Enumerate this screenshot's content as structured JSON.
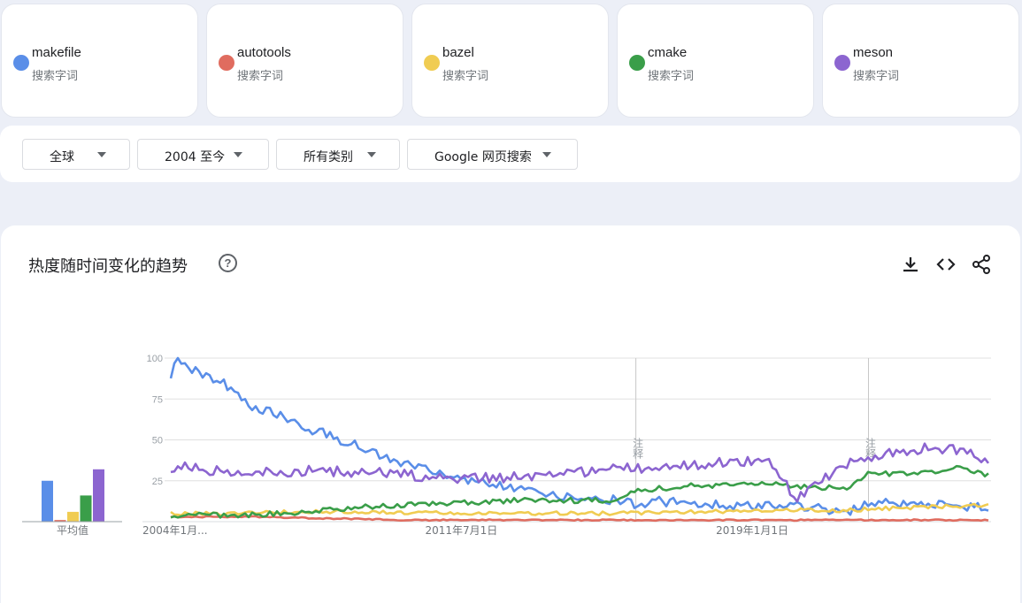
{
  "terms": [
    {
      "name": "makefile",
      "subtitle": "搜索字词",
      "color": "#5a8ee8"
    },
    {
      "name": "autotools",
      "subtitle": "搜索字词",
      "color": "#e06c5f"
    },
    {
      "name": "bazel",
      "subtitle": "搜索字词",
      "color": "#f0cc52"
    },
    {
      "name": "cmake",
      "subtitle": "搜索字词",
      "color": "#3a9e49"
    },
    {
      "name": "meson",
      "subtitle": "搜索字词",
      "color": "#8c65d0"
    }
  ],
  "filters": {
    "region": "全球",
    "time": "2004 至今",
    "category": "所有类别",
    "property": "Google 网页搜索"
  },
  "chart": {
    "title": "热度随时间变化的趋势",
    "help": "?",
    "avg_label": "平均值",
    "x_labels": [
      "2004年1月...",
      "2011年7月1日",
      "2019年1月1日"
    ],
    "y_ticks": [
      "100",
      "75",
      "50",
      "25"
    ],
    "note_label": "注释"
  },
  "chart_data": {
    "type": "line",
    "xlabel": "",
    "ylabel": "",
    "ylim": [
      0,
      100
    ],
    "x_start": "2004-01",
    "x_end": "2025-03",
    "grid": true,
    "notes_at": [
      "2016-01",
      "2022-01"
    ],
    "averages": [
      {
        "name": "makefile",
        "value": 25
      },
      {
        "name": "autotools",
        "value": 1
      },
      {
        "name": "bazel",
        "value": 6
      },
      {
        "name": "cmake",
        "value": 16
      },
      {
        "name": "meson",
        "value": 32
      }
    ],
    "series": [
      {
        "name": "makefile",
        "color": "#5a8ee8",
        "values": [
          {
            "x": "2004-01",
            "y": 88
          },
          {
            "x": "2004-03",
            "y": 100
          },
          {
            "x": "2004-09",
            "y": 92
          },
          {
            "x": "2005-06",
            "y": 84
          },
          {
            "x": "2006-01",
            "y": 72
          },
          {
            "x": "2006-09",
            "y": 66
          },
          {
            "x": "2007-06",
            "y": 58
          },
          {
            "x": "2008-06",
            "y": 50
          },
          {
            "x": "2009-06",
            "y": 40
          },
          {
            "x": "2010-06",
            "y": 33
          },
          {
            "x": "2011-06",
            "y": 27
          },
          {
            "x": "2012-06",
            "y": 22
          },
          {
            "x": "2013-06",
            "y": 17
          },
          {
            "x": "2014-06",
            "y": 14
          },
          {
            "x": "2015-06",
            "y": 13
          },
          {
            "x": "2016-01",
            "y": 10
          },
          {
            "x": "2016-06",
            "y": 13
          },
          {
            "x": "2017-06",
            "y": 11
          },
          {
            "x": "2018-06",
            "y": 10
          },
          {
            "x": "2019-06",
            "y": 10
          },
          {
            "x": "2020-06",
            "y": 9
          },
          {
            "x": "2021-06",
            "y": 6
          },
          {
            "x": "2022-01",
            "y": 12
          },
          {
            "x": "2023-01",
            "y": 10
          },
          {
            "x": "2024-01",
            "y": 10
          },
          {
            "x": "2025-03",
            "y": 8
          }
        ]
      },
      {
        "name": "autotools",
        "color": "#e06c5f",
        "values": [
          {
            "x": "2004-01",
            "y": 3
          },
          {
            "x": "2006-01",
            "y": 3
          },
          {
            "x": "2008-01",
            "y": 2
          },
          {
            "x": "2010-01",
            "y": 1
          },
          {
            "x": "2014-01",
            "y": 1
          },
          {
            "x": "2018-01",
            "y": 1
          },
          {
            "x": "2022-01",
            "y": 1
          },
          {
            "x": "2025-03",
            "y": 1
          }
        ]
      },
      {
        "name": "bazel",
        "color": "#f0cc52",
        "values": [
          {
            "x": "2004-01",
            "y": 5
          },
          {
            "x": "2005-06",
            "y": 5
          },
          {
            "x": "2007-06",
            "y": 6
          },
          {
            "x": "2009-06",
            "y": 6
          },
          {
            "x": "2011-06",
            "y": 5
          },
          {
            "x": "2013-06",
            "y": 5
          },
          {
            "x": "2015-06",
            "y": 5
          },
          {
            "x": "2017-06",
            "y": 6
          },
          {
            "x": "2019-06",
            "y": 7
          },
          {
            "x": "2021-06",
            "y": 7
          },
          {
            "x": "2023-06",
            "y": 9
          },
          {
            "x": "2025-03",
            "y": 10
          }
        ]
      },
      {
        "name": "cmake",
        "color": "#3a9e49",
        "values": [
          {
            "x": "2004-01",
            "y": 4
          },
          {
            "x": "2006-01",
            "y": 4
          },
          {
            "x": "2007-06",
            "y": 6
          },
          {
            "x": "2009-01",
            "y": 9
          },
          {
            "x": "2011-01",
            "y": 11
          },
          {
            "x": "2013-01",
            "y": 13
          },
          {
            "x": "2015-06",
            "y": 13
          },
          {
            "x": "2016-01",
            "y": 19
          },
          {
            "x": "2017-06",
            "y": 22
          },
          {
            "x": "2019-06",
            "y": 23
          },
          {
            "x": "2021-06",
            "y": 20
          },
          {
            "x": "2022-01",
            "y": 29
          },
          {
            "x": "2023-06",
            "y": 30
          },
          {
            "x": "2024-06",
            "y": 33
          },
          {
            "x": "2025-03",
            "y": 28
          }
        ]
      },
      {
        "name": "meson",
        "color": "#8c65d0",
        "values": [
          {
            "x": "2004-01",
            "y": 29
          },
          {
            "x": "2004-03",
            "y": 35
          },
          {
            "x": "2005-06",
            "y": 30
          },
          {
            "x": "2007-06",
            "y": 31
          },
          {
            "x": "2009-06",
            "y": 30
          },
          {
            "x": "2011-06",
            "y": 26
          },
          {
            "x": "2013-06",
            "y": 28
          },
          {
            "x": "2015-06",
            "y": 32
          },
          {
            "x": "2017-06",
            "y": 35
          },
          {
            "x": "2019-06",
            "y": 37
          },
          {
            "x": "2020-03",
            "y": 14
          },
          {
            "x": "2021-06",
            "y": 35
          },
          {
            "x": "2022-01",
            "y": 40
          },
          {
            "x": "2023-06",
            "y": 45
          },
          {
            "x": "2024-06",
            "y": 44
          },
          {
            "x": "2025-03",
            "y": 34
          }
        ]
      }
    ]
  }
}
